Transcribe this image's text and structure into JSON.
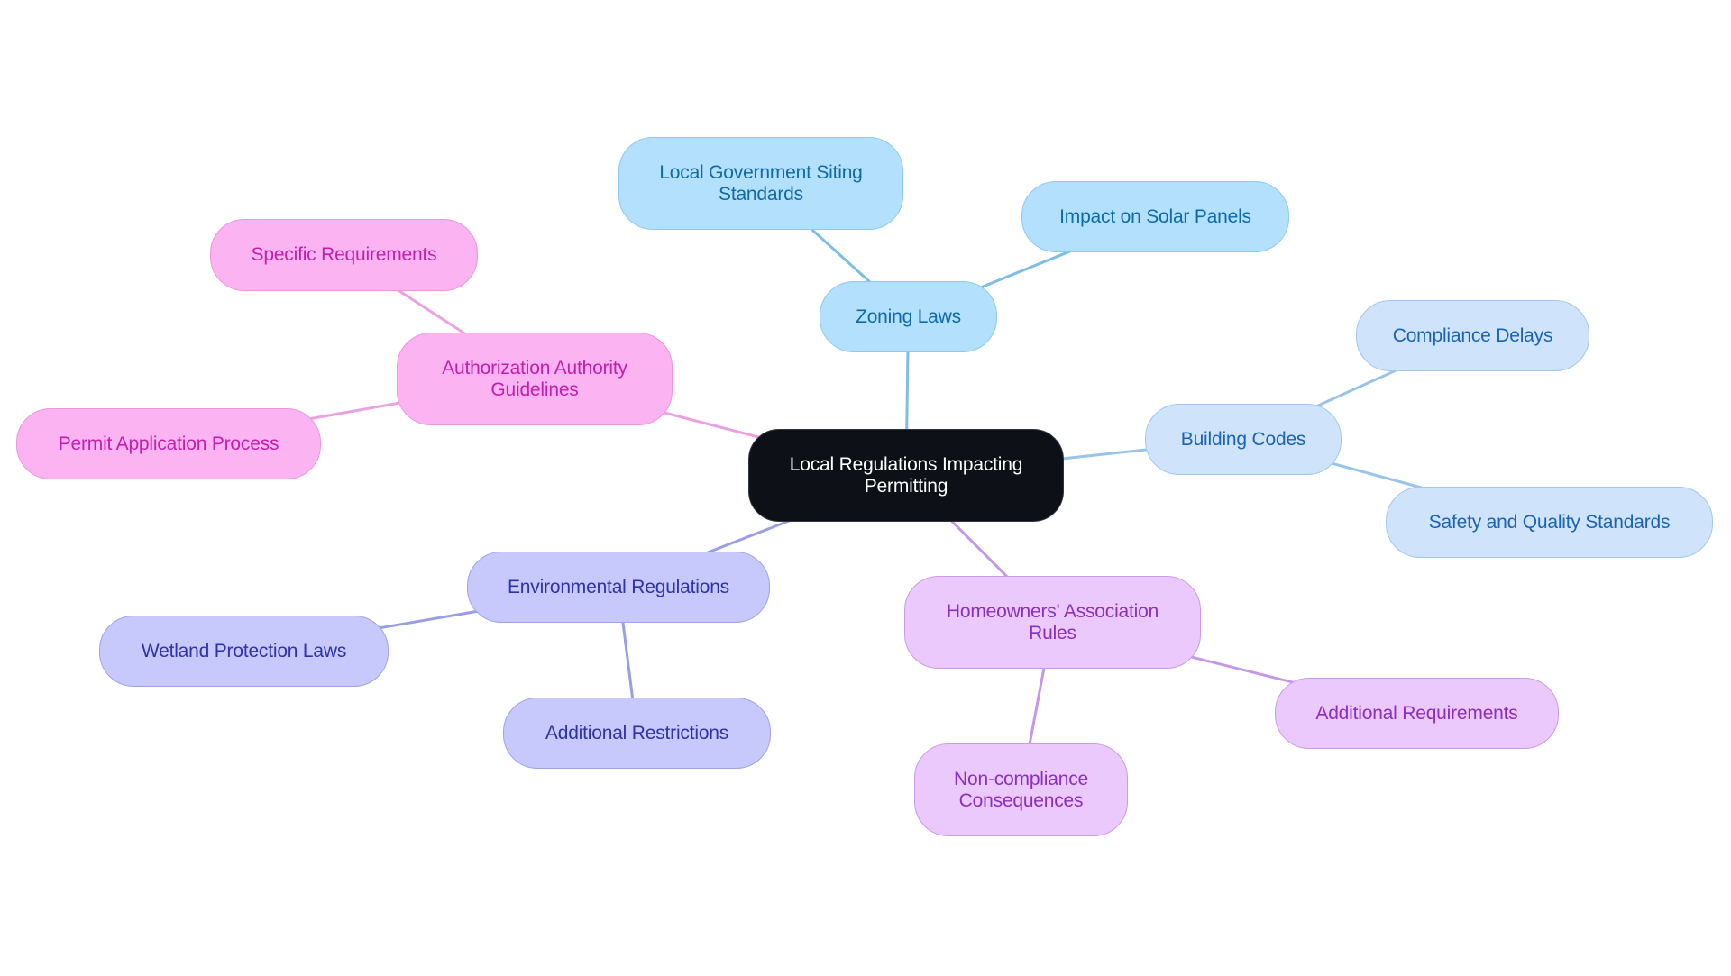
{
  "diagram": {
    "type": "mind-map",
    "root": {
      "id": "root",
      "label": "Local Regulations Impacting Permitting",
      "lines": [
        "Local Regulations Impacting",
        "Permitting"
      ],
      "colors": {
        "fill": "#0d1117",
        "border": "#30363d",
        "text": "#ffffff"
      }
    },
    "branches": [
      {
        "id": "zoning",
        "label": "Zoning Laws",
        "lines": [
          "Zoning Laws"
        ],
        "colors": {
          "fill": "#b3e0fd",
          "border": "#8ec9ee",
          "text": "#0e6aa8",
          "edge": "#7dbde6"
        },
        "children": [
          {
            "id": "siting",
            "label": "Local Government Siting Standards",
            "lines": [
              "Local Government Siting",
              "Standards"
            ]
          },
          {
            "id": "solar",
            "label": "Impact on Solar Panels",
            "lines": [
              "Impact on Solar Panels"
            ]
          }
        ]
      },
      {
        "id": "building",
        "label": "Building Codes",
        "lines": [
          "Building Codes"
        ],
        "colors": {
          "fill": "#cfe4fb",
          "border": "#a2c8ee",
          "text": "#1b63b5",
          "edge": "#9ac3ea"
        },
        "children": [
          {
            "id": "delays",
            "label": "Compliance Delays",
            "lines": [
              "Compliance Delays"
            ]
          },
          {
            "id": "safety",
            "label": "Safety and Quality Standards",
            "lines": [
              "Safety and Quality Standards"
            ]
          }
        ]
      },
      {
        "id": "hoa",
        "label": "Homeowners' Association Rules",
        "lines": [
          "Homeowners' Association",
          "Rules"
        ],
        "colors": {
          "fill": "#ebc9fd",
          "border": "#c79deb",
          "text": "#8a2fbf",
          "edge": "#c597ea"
        },
        "children": [
          {
            "id": "addreq",
            "label": "Additional Requirements",
            "lines": [
              "Additional Requirements"
            ]
          },
          {
            "id": "noncomp",
            "label": "Non-compliance Consequences",
            "lines": [
              "Non-compliance",
              "Consequences"
            ]
          }
        ]
      },
      {
        "id": "env",
        "label": "Environmental Regulations",
        "lines": [
          "Environmental Regulations"
        ],
        "colors": {
          "fill": "#c7c9fd",
          "border": "#9fa3ea",
          "text": "#2f33a8",
          "edge": "#9a9ee6"
        },
        "children": [
          {
            "id": "wetland",
            "label": "Wetland Protection Laws",
            "lines": [
              "Wetland Protection Laws"
            ]
          },
          {
            "id": "restrict",
            "label": "Additional Restrictions",
            "lines": [
              "Additional Restrictions"
            ]
          }
        ]
      },
      {
        "id": "auth",
        "label": "Authorization Authority Guidelines",
        "lines": [
          "Authorization Authority",
          "Guidelines"
        ],
        "colors": {
          "fill": "#fcb3f2",
          "border": "#eb97df",
          "text": "#c21fae",
          "edge": "#eba0e2"
        },
        "children": [
          {
            "id": "specific",
            "label": "Specific Requirements",
            "lines": [
              "Specific Requirements"
            ]
          },
          {
            "id": "permit",
            "label": "Permit Application Process",
            "lines": [
              "Permit Application Process"
            ]
          }
        ]
      }
    ]
  }
}
